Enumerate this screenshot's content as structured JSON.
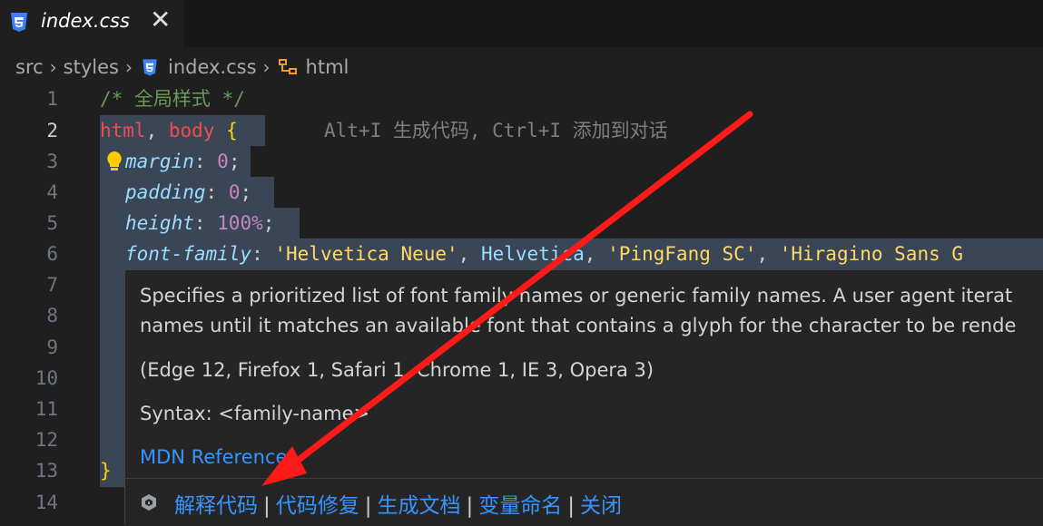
{
  "tab": {
    "label": "index.css",
    "close_glyph": "✕"
  },
  "breadcrumb": {
    "items": [
      "src",
      "styles",
      "index.css",
      "html"
    ],
    "separator": "›"
  },
  "editor": {
    "line_numbers": [
      "1",
      "2",
      "3",
      "4",
      "5",
      "6",
      "7",
      "8",
      "9",
      "10",
      "11",
      "12",
      "13",
      "14"
    ],
    "active_line": "2",
    "line1_comment": "/* 全局样式 */",
    "line2": {
      "sel1": "html",
      "comma": ", ",
      "sel2": "body",
      "brace": " {"
    },
    "ghost_hint": "Alt+I 生成代码, Ctrl+I 添加到对话",
    "line3": {
      "prop": "margin",
      "colon": ": ",
      "value": "0",
      "semi": ";"
    },
    "line4": {
      "prop": "padding",
      "colon": ": ",
      "value": "0",
      "semi": ";"
    },
    "line5": {
      "prop": "height",
      "colon": ": ",
      "value": "100%",
      "semi": ";"
    },
    "line6": {
      "prop": "font-family",
      "colon": ": ",
      "v1": "'Helvetica Neue'",
      "c1": ", ",
      "v2": "Helvetica",
      "c2": ", ",
      "v3": "'PingFang SC'",
      "c3": ", ",
      "v4": "'Hiragino Sans G"
    },
    "line13": "}"
  },
  "hover": {
    "desc1": "Specifies a prioritized list of font family names or generic family names. A user agent iterat",
    "desc2": "names until it matches an available font that contains a glyph for the character to be rende",
    "compat": "(Edge 12, Firefox 1, Safari 1, Chrome 1, IE 3, Opera 3)",
    "syntax": "Syntax: <family-name>",
    "mdn": "MDN Reference",
    "actions": [
      "解释代码",
      "代码修复",
      "生成文档",
      "变量命名",
      "关闭"
    ],
    "action_sep": "|"
  },
  "colors": {
    "background": "#1f1f1f",
    "selection": "#3a4556",
    "link": "#3794ff",
    "annotation_arrow": "#ff1a1a"
  },
  "icons": {
    "tab": "css3-icon",
    "breadcrumb_file": "css3-icon",
    "breadcrumb_symbol": "symbol-class-icon",
    "lightbulb": "lightbulb-icon",
    "action": "ai-assistant-icon"
  }
}
